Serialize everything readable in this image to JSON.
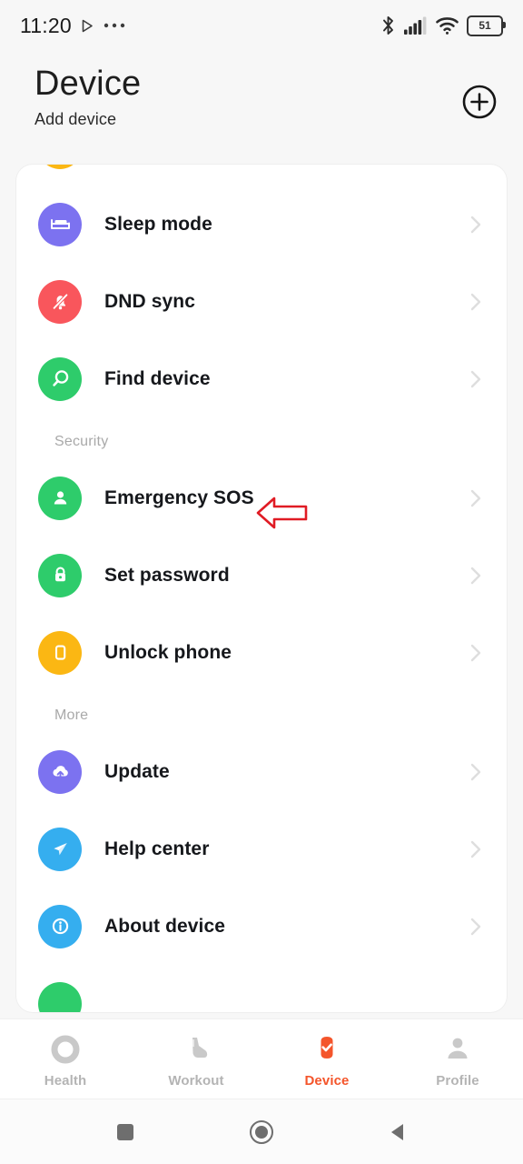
{
  "status_bar": {
    "time": "11:20",
    "battery_level": "51",
    "icons": [
      "play-icon",
      "ellipsis-icon",
      "bluetooth-icon",
      "cellular-signal-icon",
      "wifi-icon",
      "battery-icon"
    ]
  },
  "header": {
    "title": "Device",
    "subtitle": "Add device",
    "add_button": "add-device-button"
  },
  "list": {
    "clipped_top_item": {
      "label": "",
      "icon_color": "#FBB713"
    },
    "sections": [
      {
        "heading": null,
        "items": [
          {
            "label": "Sleep mode",
            "icon": "bed-icon",
            "color": "#7C72F0"
          },
          {
            "label": "DND sync",
            "icon": "bell-off-icon",
            "color": "#F9565C"
          },
          {
            "label": "Find device",
            "icon": "search-icon",
            "color": "#2ECC6B"
          }
        ]
      },
      {
        "heading": "Security",
        "items": [
          {
            "label": "Emergency SOS",
            "icon": "person-icon",
            "color": "#2ECC6B"
          },
          {
            "label": "Set password",
            "icon": "lock-icon",
            "color": "#2ECC6B"
          },
          {
            "label": "Unlock phone",
            "icon": "phone-icon",
            "color": "#FBB713"
          }
        ]
      },
      {
        "heading": "More",
        "items": [
          {
            "label": "Update",
            "icon": "cloud-upload-icon",
            "color": "#7C72F0"
          },
          {
            "label": "Help center",
            "icon": "paper-plane-icon",
            "color": "#35AEEF"
          },
          {
            "label": "About device",
            "icon": "info-icon",
            "color": "#35AEEF"
          }
        ]
      }
    ],
    "clipped_bottom_item": {
      "label": "",
      "icon_color": "#2ECC6B"
    }
  },
  "annotation": {
    "shape": "left-arrow",
    "color": "#E01B24",
    "points_at": "Emergency SOS"
  },
  "tabbar": {
    "active": "Device",
    "accent_color": "#F4552B",
    "inactive_color": "#B4B4B4",
    "tabs": [
      {
        "label": "Health",
        "icon": "ring-icon"
      },
      {
        "label": "Workout",
        "icon": "shoe-icon"
      },
      {
        "label": "Device",
        "icon": "watch-check-icon"
      },
      {
        "label": "Profile",
        "icon": "person-icon"
      }
    ]
  },
  "system_nav": {
    "buttons": [
      {
        "name": "recents",
        "icon": "square-icon"
      },
      {
        "name": "home",
        "icon": "circle-icon"
      },
      {
        "name": "back",
        "icon": "triangle-left-icon"
      }
    ]
  }
}
